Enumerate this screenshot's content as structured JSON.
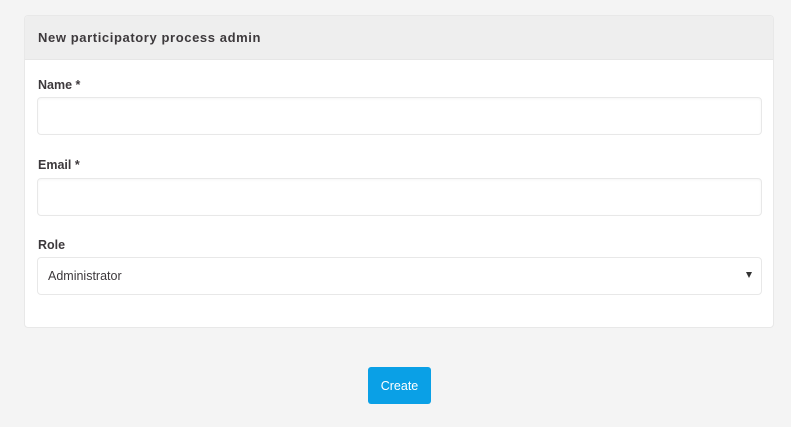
{
  "form": {
    "title": "New participatory process admin",
    "fields": {
      "name": {
        "label": "Name *",
        "value": "",
        "placeholder": ""
      },
      "email": {
        "label": "Email *",
        "value": "",
        "placeholder": ""
      },
      "role": {
        "label": "Role",
        "selected": "Administrator"
      }
    },
    "submit_label": "Create"
  },
  "colors": {
    "page_background": "#f4f4f4",
    "header_background": "#eeeeee",
    "primary_button": "#0aa0e6",
    "text": "#3d393c"
  }
}
